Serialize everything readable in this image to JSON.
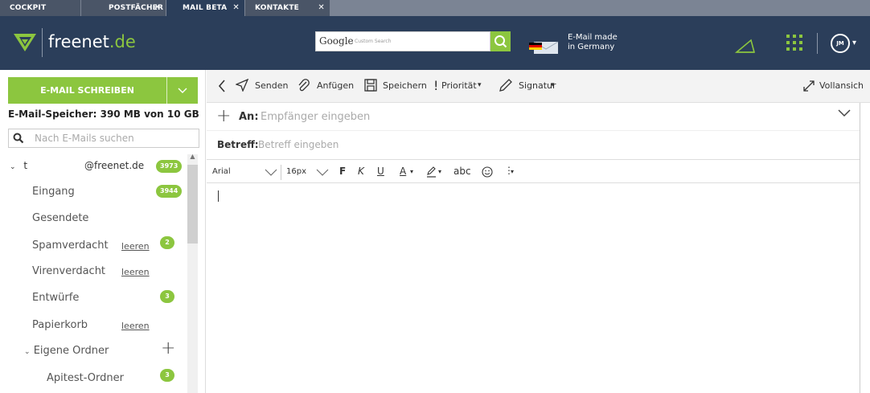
{
  "tabs": [
    {
      "label": "COCKPIT",
      "closable": false
    },
    {
      "label": "POSTFÄCHER",
      "closable": true
    },
    {
      "label": "MAIL BETA",
      "closable": true,
      "active": true
    },
    {
      "label": "KONTAKTE",
      "closable": true
    }
  ],
  "header": {
    "brand": "freenet",
    "brand_tld": ".de",
    "search_brand": "Google",
    "search_hint": "Custom Search",
    "made_line1": "E-Mail made",
    "made_line2": "in Germany",
    "avatar_initials": "JM"
  },
  "colors": {
    "accent": "#8cc63f",
    "header": "#2b3e5a",
    "tabbar": "#7b8494"
  },
  "sidebar": {
    "compose_label": "E-MAIL SCHREIBEN",
    "storage": "E-Mail-Speicher: 390 MB von 10 GB",
    "search_placeholder": "Nach E-Mails suchen",
    "account_prefix": "t",
    "account_domain": "@freenet.de",
    "account_count": "3973",
    "folders": [
      {
        "label": "Eingang",
        "badge": "3944",
        "action": ""
      },
      {
        "label": "Gesendete",
        "badge": "",
        "action": ""
      },
      {
        "label": "Spamverdacht",
        "badge": "2",
        "action": "leeren"
      },
      {
        "label": "Virenverdacht",
        "badge": "",
        "action": "leeren"
      },
      {
        "label": "Entwürfe",
        "badge": "3",
        "action": ""
      },
      {
        "label": "Papierkorb",
        "badge": "",
        "action": "leeren"
      }
    ],
    "own_folders_label": "Eigene Ordner",
    "custom_folders": [
      {
        "label": "Apitest-Ordner",
        "badge": "3"
      }
    ]
  },
  "toolbar": {
    "send": "Senden",
    "attach": "Anfügen",
    "save": "Speichern",
    "priority": "Priorität",
    "signature": "Signatur",
    "fullscreen": "Vollansich"
  },
  "compose": {
    "to_label": "An:",
    "to_placeholder": "Empfänger eingeben",
    "subject_label": "Betreff:",
    "subject_placeholder": "Betreff eingeben"
  },
  "format": {
    "font": "Arial",
    "size": "16px",
    "bold": "F",
    "italic": "K",
    "underline": "U",
    "spell": "abc"
  }
}
